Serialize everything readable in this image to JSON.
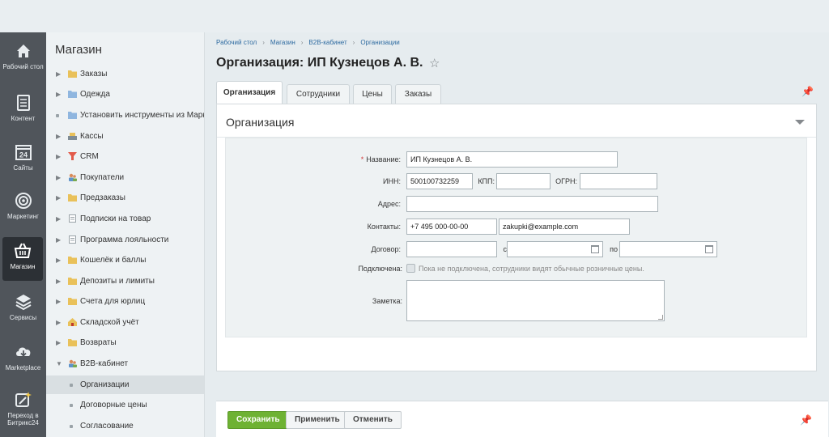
{
  "rail": [
    {
      "label": "Рабочий стол",
      "icon": "home-icon"
    },
    {
      "label": "Контент",
      "icon": "document-icon"
    },
    {
      "label": "Сайты",
      "icon": "calendar-24-icon",
      "badge": "24"
    },
    {
      "label": "Маркетинг",
      "icon": "target-icon"
    },
    {
      "label": "Магазин",
      "icon": "basket-icon"
    },
    {
      "label": "Сервисы",
      "icon": "layers-icon"
    },
    {
      "label": "Marketplace",
      "icon": "cloud-download-icon"
    },
    {
      "label": "Переход в Битрикс24",
      "icon": "magic-wand-icon"
    }
  ],
  "menu": {
    "title": "Магазин",
    "items": [
      {
        "label": "Заказы",
        "icon": "folder-icon"
      },
      {
        "label": "Одежда",
        "icon": "folder-icon"
      },
      {
        "label": "Установить инструменты из Маркетплейс",
        "icon": "folder-icon"
      },
      {
        "label": "Кассы",
        "icon": "cash-icon"
      },
      {
        "label": "CRM",
        "icon": "crm-icon"
      },
      {
        "label": "Покупатели",
        "icon": "users-icon"
      },
      {
        "label": "Предзаказы",
        "icon": "folder-icon"
      },
      {
        "label": "Подписки на товар",
        "icon": "page-icon"
      },
      {
        "label": "Программа лояльности",
        "icon": "page-icon"
      },
      {
        "label": "Кошелёк и баллы",
        "icon": "folder-icon"
      },
      {
        "label": "Депозиты и лимиты",
        "icon": "folder-icon"
      },
      {
        "label": "Счета для юрлиц",
        "icon": "folder-icon"
      },
      {
        "label": "Складской учёт",
        "icon": "warehouse-icon"
      },
      {
        "label": "Возвраты",
        "icon": "folder-icon"
      },
      {
        "label": "B2B-кабинет",
        "icon": "users-icon"
      }
    ],
    "subitems": [
      {
        "label": "Организации",
        "active": true
      },
      {
        "label": "Договорные цены",
        "active": false
      },
      {
        "label": "Согласование",
        "active": false
      }
    ]
  },
  "breadcrumbs": [
    "Рабочий стол",
    "Магазин",
    "B2B-кабинет",
    "Организации"
  ],
  "page": {
    "title": "Организация: ИП Кузнецов А. В."
  },
  "tabs": [
    "Организация",
    "Сотрудники",
    "Цены",
    "Заказы"
  ],
  "panel": {
    "title": "Организация"
  },
  "form": {
    "name_label": "Название:",
    "name_value": "ИП Кузнецов А. В.",
    "inn_label": "ИНН:",
    "inn_value": "500100732259",
    "kpp_label": "КПП:",
    "kpp_value": "",
    "ogrn_label": "ОГРН:",
    "ogrn_value": "",
    "address_label": "Адрес:",
    "address_value": "",
    "contacts_label": "Контакты:",
    "phone_value": "+7 495 000-00-00",
    "email_value": "zakupki@example.com",
    "contract_label": "Договор:",
    "contract_value": "",
    "from_label": "с",
    "to_label": "по",
    "connected_label": "Подключена:",
    "connected_hint": "Пока не подключена, сотрудники видят обычные розничные цены.",
    "note_label": "Заметка:",
    "note_value": ""
  },
  "buttons": {
    "save": "Сохранить",
    "apply": "Применить",
    "cancel": "Отменить"
  },
  "colors": {
    "accent": "#6eb233",
    "link": "#2d6aa0",
    "rail": "#50555b"
  }
}
